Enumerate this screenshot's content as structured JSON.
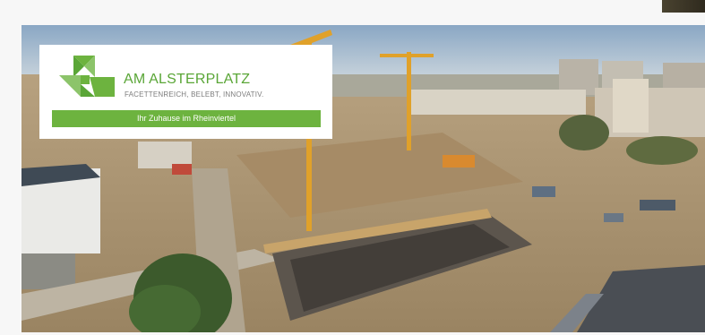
{
  "brand": {
    "title": "AM ALSTERPLATZ",
    "tagline": "FACETTENREICH, BELEBT, INNOVATIV.",
    "banner": "Ihr Zuhause im Rheinviertel",
    "logo": "am-alsterplatz-logo",
    "colors": {
      "primary": "#6db33f",
      "title": "#5aa637",
      "tagline": "#7d7d7d"
    }
  },
  "photo": {
    "subject": "aerial view of construction site with cranes and apartment blocks"
  }
}
